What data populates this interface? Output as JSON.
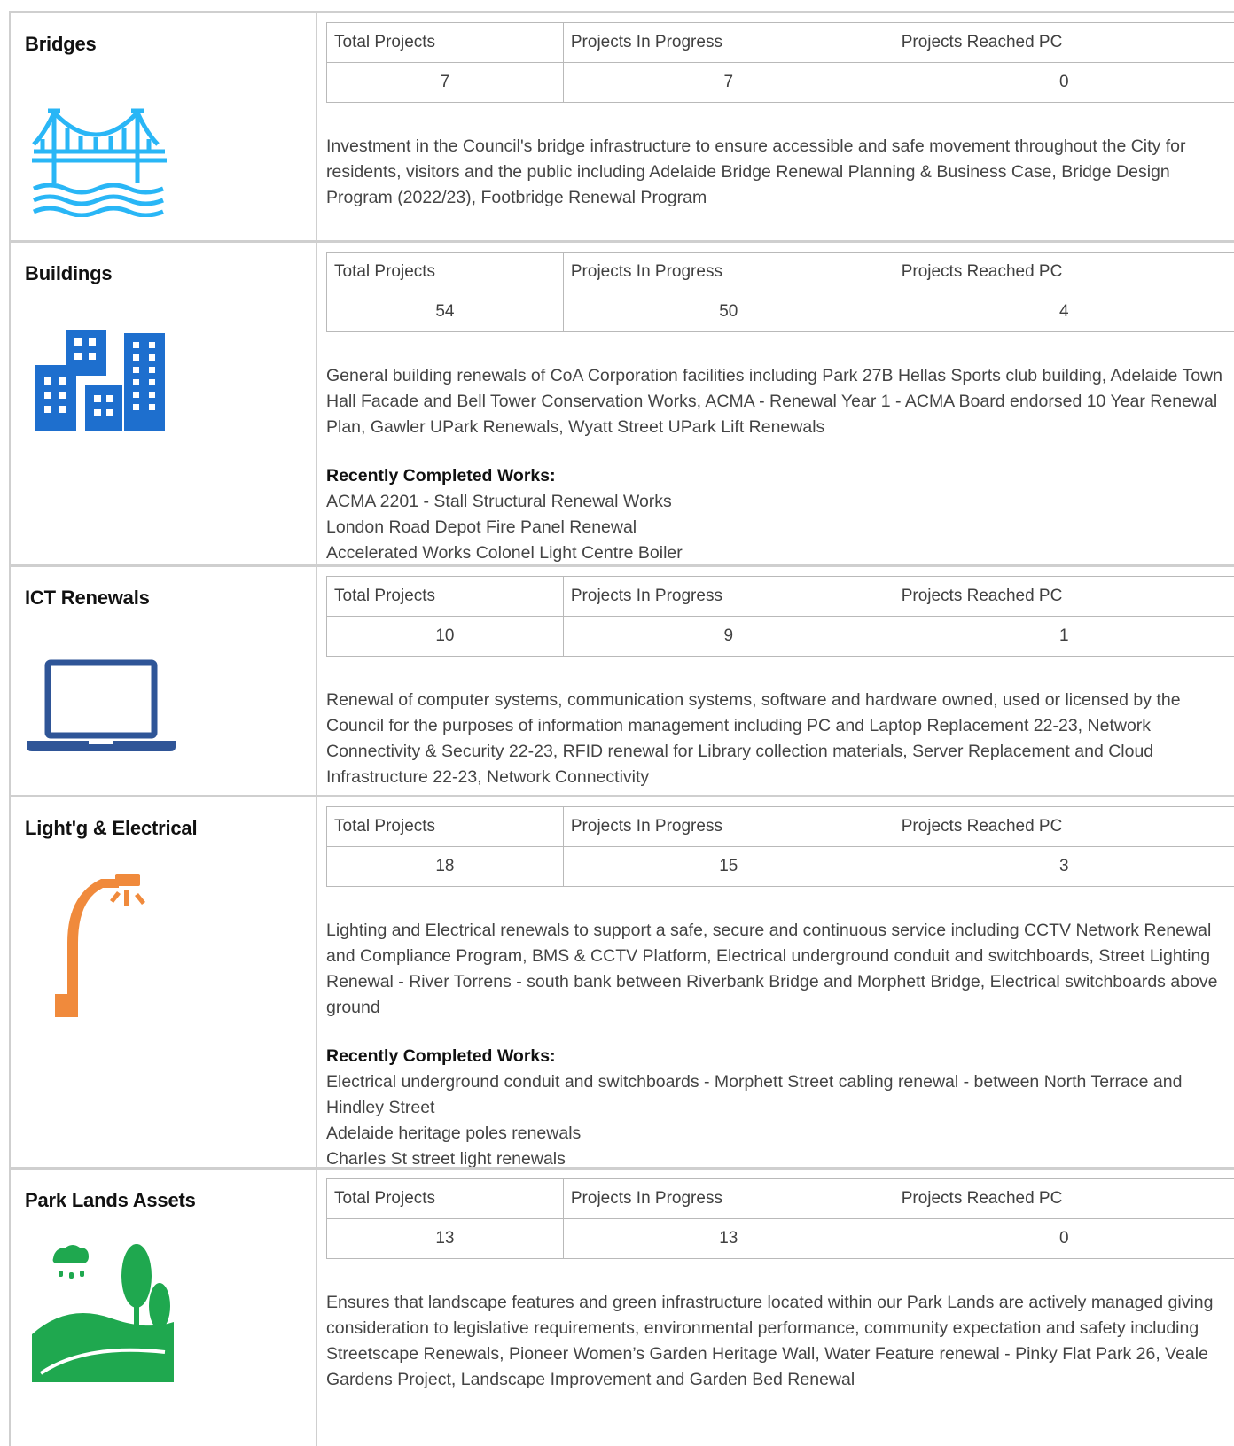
{
  "headers": {
    "total": "Total Projects",
    "in_progress": "Projects In Progress",
    "reached_pc": "Projects Reached PC"
  },
  "recently_completed_label": "Recently Completed Works:",
  "categories": [
    {
      "title": "Bridges",
      "icon": "bridge-icon",
      "color": "#29b6f6",
      "total": "7",
      "in_progress": "7",
      "reached_pc": "0",
      "description": "Investment in the Council's bridge infrastructure to ensure accessible and safe movement throughout the City for residents, visitors and the public including Adelaide Bridge Renewal Planning & Business Case, Bridge Design Program (2022/23), Footbridge Renewal Program",
      "completed": []
    },
    {
      "title": "Buildings",
      "icon": "buildings-icon",
      "color": "#1e6fce",
      "total": "54",
      "in_progress": "50",
      "reached_pc": "4",
      "description": "General building renewals of CoA Corporation facilities including Park 27B Hellas Sports club building, Adelaide Town Hall Facade and Bell Tower Conservation Works, ACMA - Renewal Year 1 - ACMA Board endorsed 10 Year Renewal Plan, Gawler UPark Renewals, Wyatt Street UPark Lift Renewals",
      "completed": [
        "ACMA 2201 - Stall Structural Renewal Works",
        "London Road Depot Fire Panel Renewal",
        "Accelerated Works Colonel Light Centre Boiler"
      ]
    },
    {
      "title": "ICT Renewals",
      "icon": "laptop-icon",
      "color": "#2f5597",
      "total": "10",
      "in_progress": "9",
      "reached_pc": "1",
      "description": "Renewal of computer systems, communication systems, software and hardware owned, used or licensed by the Council for the purposes of information management including PC and Laptop Replacement 22-23, Network Connectivity & Security 22-23, RFID renewal for Library collection materials, Server Replacement and Cloud Infrastructure 22-23, Network Connectivity",
      "completed": []
    },
    {
      "title": "Light'g & Electrical",
      "icon": "street-light-icon",
      "color": "#f08a3c",
      "total": "18",
      "in_progress": "15",
      "reached_pc": "3",
      "description": "Lighting and Electrical renewals to support a safe, secure and continuous service including CCTV Network Renewal and Compliance Program, BMS & CCTV Platform, Electrical underground conduit and switchboards, Street Lighting Renewal - River Torrens - south bank between Riverbank Bridge and Morphett Bridge, Electrical switchboards above ground",
      "completed": [
        "Electrical underground conduit and switchboards - Morphett Street cabling renewal - between North Terrace and Hindley Street",
        "Adelaide heritage poles renewals",
        "Charles St street light renewals"
      ]
    },
    {
      "title": "Park Lands Assets",
      "icon": "park-icon",
      "color": "#1fa84f",
      "total": "13",
      "in_progress": "13",
      "reached_pc": "0",
      "description": "Ensures that landscape features and green infrastructure located within our Park Lands are actively managed giving consideration to legislative requirements, environmental performance, community expectation and safety including Streetscape Renewals, Pioneer Women’s Garden Heritage Wall, Water Feature renewal - Pinky Flat Park 26, Veale Gardens Project, Landscape Improvement and Garden Bed Renewal",
      "completed": []
    }
  ]
}
